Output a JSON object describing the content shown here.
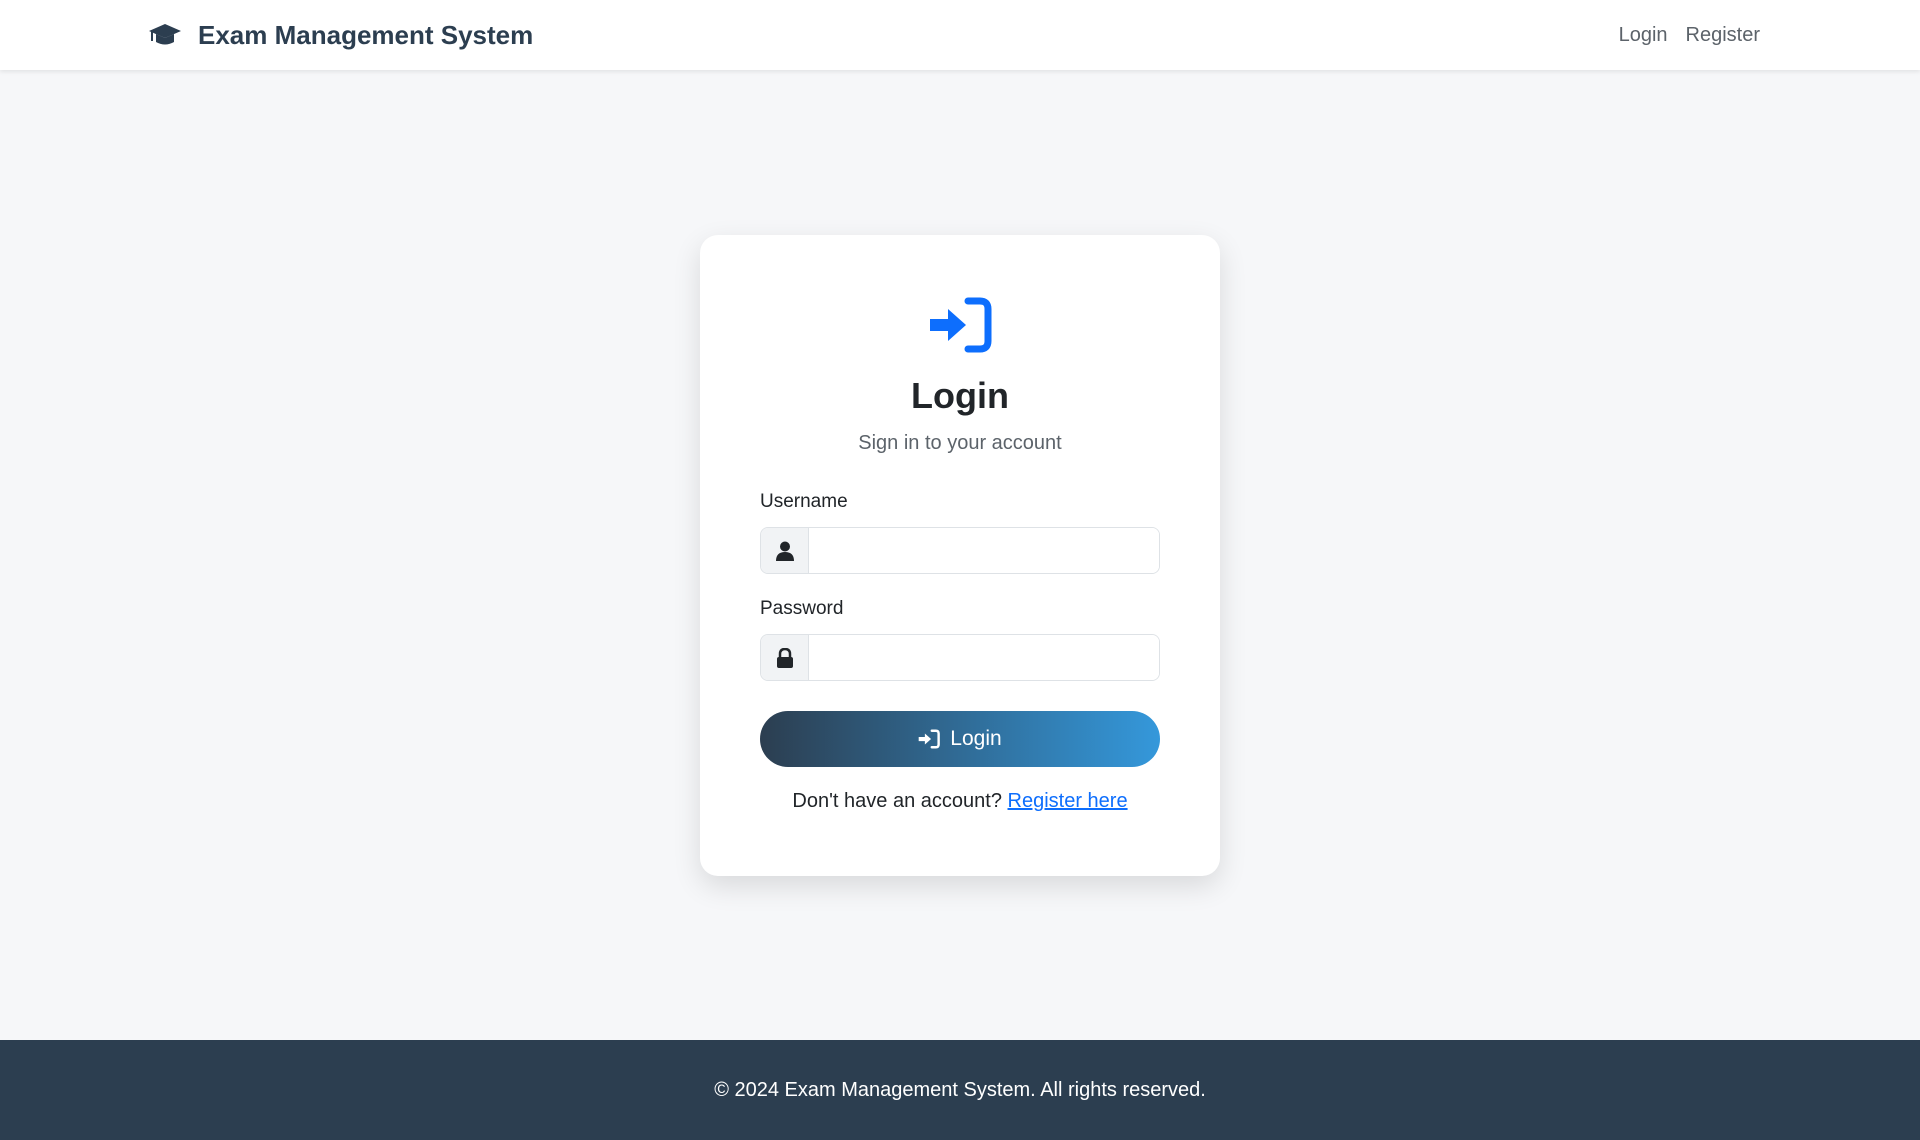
{
  "navbar": {
    "brand_text": "Exam Management System",
    "brand_icon": "graduation-cap-icon",
    "links": [
      {
        "label": "Login"
      },
      {
        "label": "Register"
      }
    ]
  },
  "login_card": {
    "icon": "sign-in-icon",
    "title": "Login",
    "subtitle": "Sign in to your account",
    "username": {
      "label": "Username",
      "value": "",
      "placeholder": "",
      "icon": "user-icon"
    },
    "password": {
      "label": "Password",
      "value": "",
      "placeholder": "",
      "icon": "lock-icon"
    },
    "submit_label": "Login",
    "register_prompt": "Don't have an account?",
    "register_link": "Register here"
  },
  "footer": {
    "text": "© 2024 Exam Management System. All rights reserved."
  },
  "colors": {
    "brand": "#2c3e50",
    "accent": "#0d6efd",
    "button_gradient_start": "#2c3e50",
    "button_gradient_end": "#3498db",
    "background": "#f6f7f9"
  }
}
